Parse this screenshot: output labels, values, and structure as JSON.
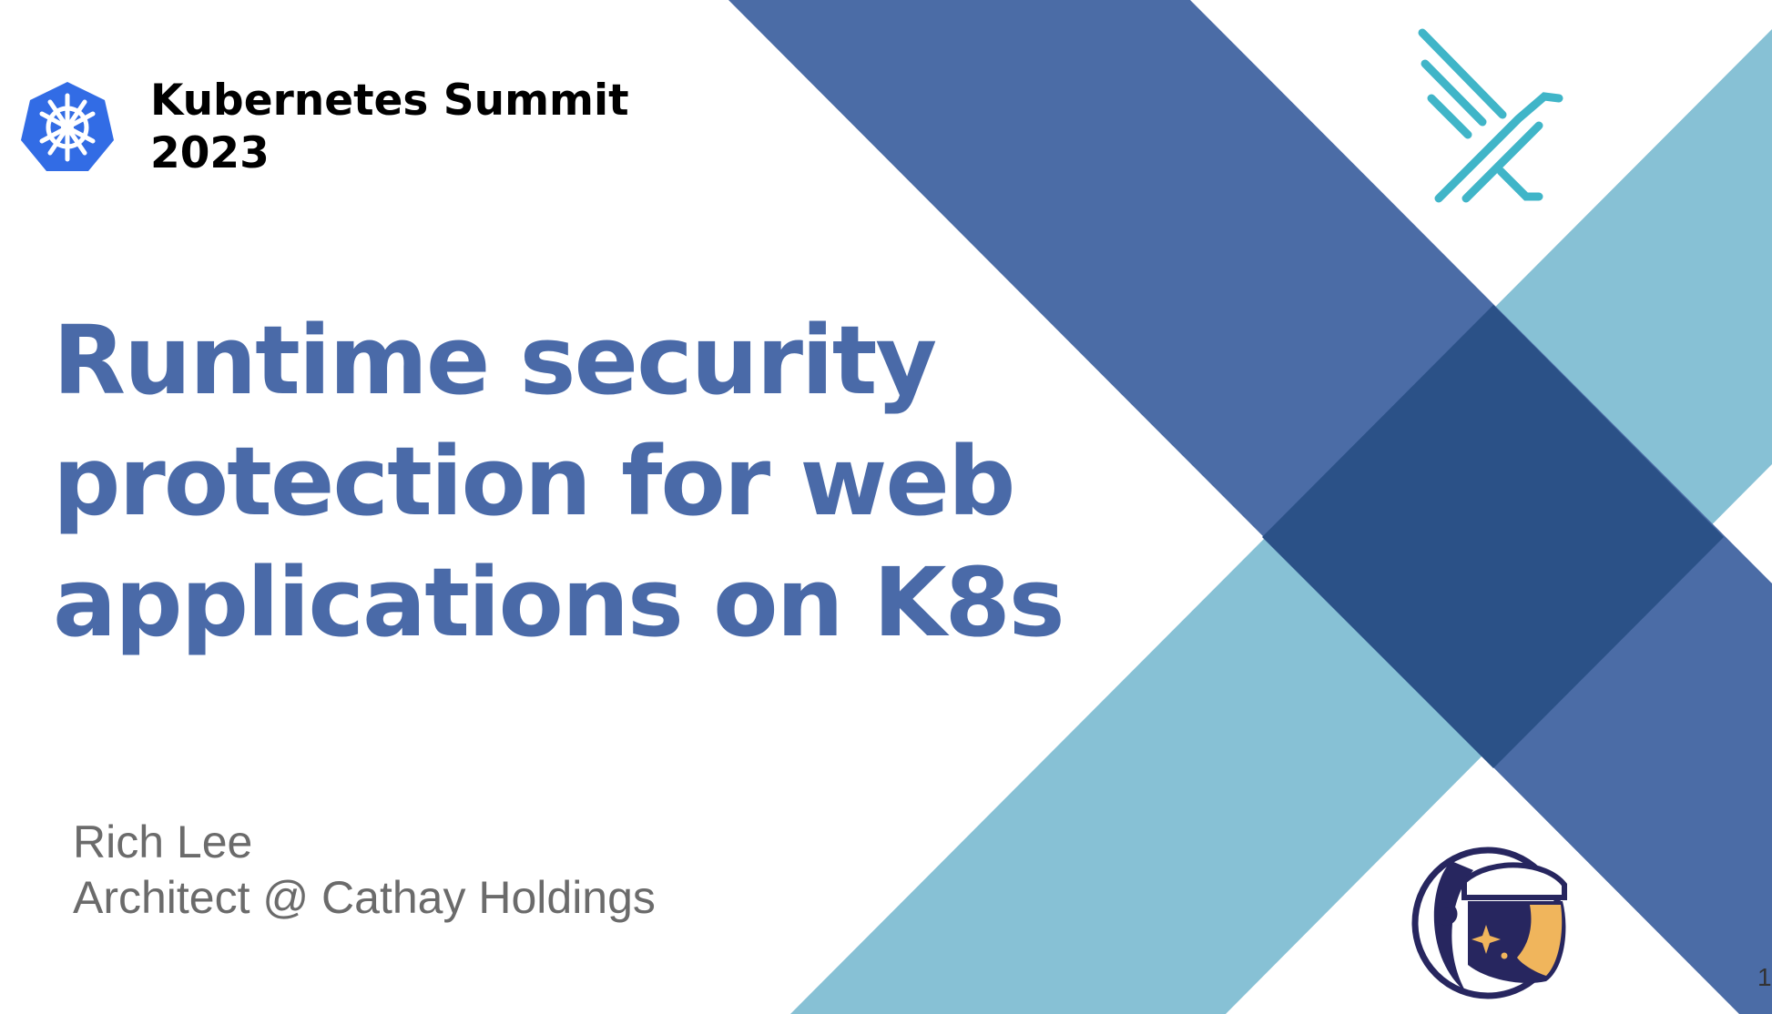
{
  "slide": {
    "event_title_line1": "Kubernetes Summit",
    "event_title_line2": "2023",
    "title_line1": "Runtime security",
    "title_line2": "protection for web",
    "title_line3": "applications on K8s",
    "presenter_name": "Rich Lee",
    "presenter_role": "Architect @ Cathay Holdings",
    "slide_number": "1"
  },
  "icons": {
    "kubernetes_logo": "kubernetes-helm-wheel-icon",
    "falco_logo": "falco-bird-lines-icon",
    "astronaut_logo": "astronaut-helmet-icon"
  },
  "colors": {
    "title_blue": "#4a6aa8",
    "band_dark_blue": "#4b6ca6",
    "band_light_blue": "#87c1d5",
    "band_overlap": "#2b5187",
    "kubernetes_blue": "#326ce5",
    "falco_teal": "#40b5c8",
    "astronaut_navy": "#27265f",
    "astronaut_gold": "#f0b55c",
    "presenter_gray": "#6b6b6b"
  }
}
